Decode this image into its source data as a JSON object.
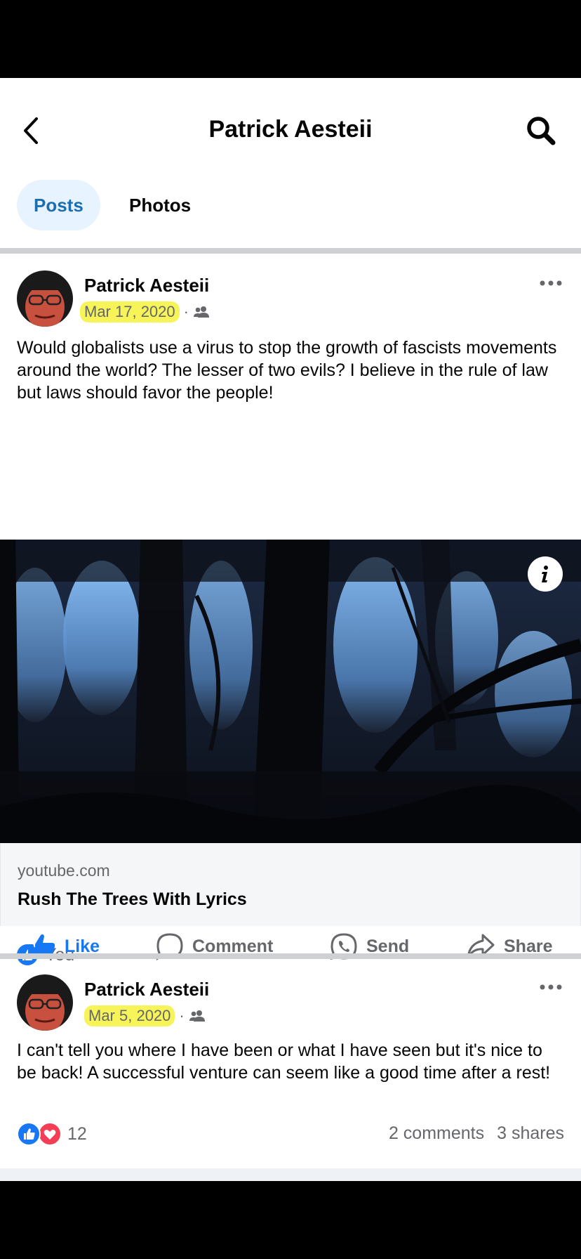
{
  "header": {
    "title": "Patrick Aesteii"
  },
  "tabs": [
    {
      "label": "Posts"
    },
    {
      "label": "Photos"
    }
  ],
  "posts": [
    {
      "author": "Patrick Aesteii",
      "date": "Mar 17, 2020",
      "separator": "·",
      "audience_icon": "friends-icon",
      "text": "Would globalists use a virus to stop the growth of fascists movements around the world? The lesser of two evils? I believe in the rule of law but laws should favor the people!",
      "link": {
        "domain": "youtube.com",
        "title": "Rush The Trees With Lyrics"
      },
      "reactions_label": "You",
      "actions": {
        "like": "Like",
        "comment": "Comment",
        "send": "Send",
        "share": "Share"
      }
    },
    {
      "author": "Patrick Aesteii",
      "date": "Mar 5, 2020",
      "separator": "·",
      "audience_icon": "friends-icon",
      "text": "I can't tell you where I have been or what I have seen but it's nice to be back! A successful venture can seem like a good time after a rest!",
      "reaction_count": "12",
      "comments": "2 comments",
      "shares": "3 shares"
    }
  ],
  "colors": {
    "accent": "#1877f2",
    "highlight": "#f7f45a",
    "love": "#f33e58"
  }
}
